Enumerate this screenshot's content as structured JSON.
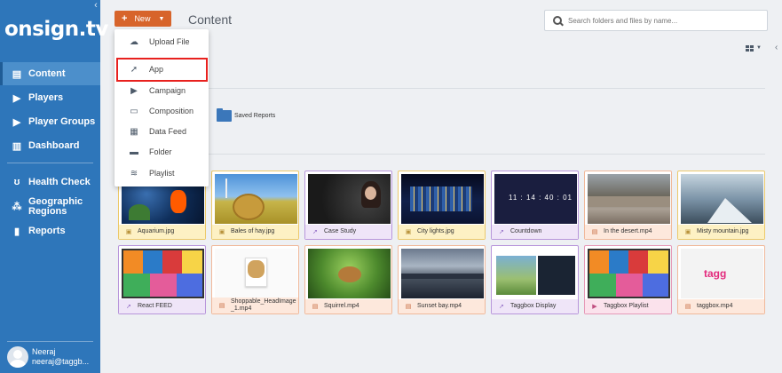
{
  "sidebar": {
    "logo": "onsign.tv",
    "collapse_glyph": "‹",
    "items": [
      {
        "label": "Content",
        "icon": "content-icon",
        "active": true
      },
      {
        "label": "Players",
        "icon": "play-icon"
      },
      {
        "label": "Player Groups",
        "icon": "play-icon"
      },
      {
        "label": "Dashboard",
        "icon": "dashboard-icon"
      },
      {
        "label": "Health Check",
        "icon": "stethoscope-icon"
      },
      {
        "label": "Geographic Regions",
        "icon": "map-pins-icon"
      },
      {
        "label": "Reports",
        "icon": "clipboard-icon"
      }
    ],
    "user": {
      "name": "Neeraj",
      "email": "neeraj@taggb..."
    }
  },
  "header": {
    "new_label": "New",
    "title": "Content",
    "search_placeholder": "Search folders and files by name..."
  },
  "new_menu": {
    "items": [
      {
        "label": "Upload File",
        "icon": "cloud-upload-icon"
      },
      {
        "label": "App",
        "icon": "rocket-icon",
        "highlighted": true
      },
      {
        "label": "Campaign",
        "icon": "campaign-icon"
      },
      {
        "label": "Composition",
        "icon": "monitor-icon"
      },
      {
        "label": "Data Feed",
        "icon": "data-feed-icon"
      },
      {
        "label": "Folder",
        "icon": "folder-icon"
      },
      {
        "label": "Playlist",
        "icon": "layers-icon"
      }
    ]
  },
  "folders": [
    {
      "label": "Saved Reports",
      "icon": "folder-icon"
    }
  ],
  "files": [
    {
      "name": "Aquarium.jpg",
      "type": "image"
    },
    {
      "name": "Bales of hay.jpg",
      "type": "image"
    },
    {
      "name": "Case Study",
      "type": "app"
    },
    {
      "name": "City lights.jpg",
      "type": "image"
    },
    {
      "name": "Countdown",
      "type": "app",
      "thumb_text": "11 : 14 : 40 : 01"
    },
    {
      "name": "In the desert.mp4",
      "type": "video"
    },
    {
      "name": "Misty mountain.jpg",
      "type": "image"
    },
    {
      "name": "React FEED",
      "type": "app"
    },
    {
      "name": "Shoppable_HeadImage_1.mp4",
      "type": "video"
    },
    {
      "name": "Squirrel.mp4",
      "type": "video"
    },
    {
      "name": "Sunset bay.mp4",
      "type": "video"
    },
    {
      "name": "Taggbox Display",
      "type": "app"
    },
    {
      "name": "Taggbox Playlist",
      "type": "campaign"
    },
    {
      "name": "taggbox.mp4",
      "type": "video",
      "thumb_text": "tagg"
    }
  ]
}
